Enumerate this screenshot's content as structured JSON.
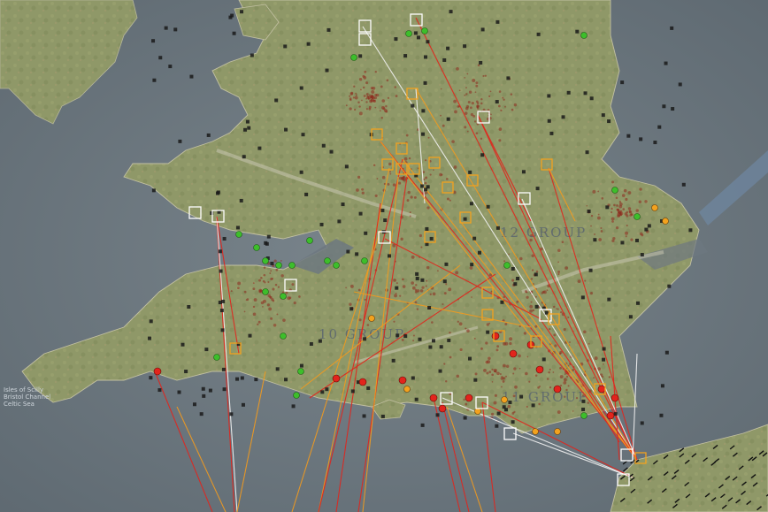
{
  "map": {
    "group_labels": {
      "group_12": "12 GROUP",
      "group_10": "10 GROUP",
      "group_11": "11 GROUP"
    },
    "sea_note": {
      "line1": "Isles of Scilly",
      "line2": "Bristol Channel",
      "line3": "Celtic Sea"
    },
    "colors": {
      "sea": "#6d7880",
      "land": "#8c9567",
      "raid_red": "#e2241c",
      "raid_orange": "#f29a1e",
      "raid_white": "#f2f2f2",
      "friendly_green": "#3dbe2b",
      "marker_orange": "#f2a21e",
      "marker_white": "#ffffff"
    }
  }
}
